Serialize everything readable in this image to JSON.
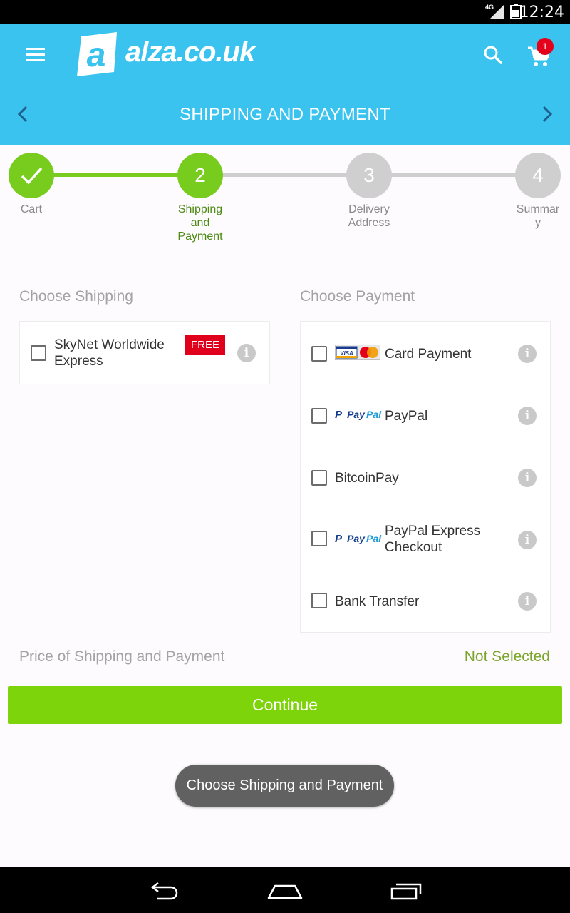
{
  "status_bar": {
    "network": "4G",
    "time": "12:24"
  },
  "header": {
    "brand": "alza.co.uk",
    "cart_count": "1",
    "title": "SHIPPING AND PAYMENT",
    "accent_color": "#3bc3ef"
  },
  "steps": [
    {
      "number": "",
      "label": "Cart",
      "state": "done"
    },
    {
      "number": "2",
      "label": "Shipping and Payment",
      "label_lines": [
        "Shipping",
        "and",
        "Payment"
      ],
      "state": "active"
    },
    {
      "number": "3",
      "label": "Delivery Address",
      "label_lines": [
        "Delivery",
        "Address"
      ],
      "state": "pending"
    },
    {
      "number": "4",
      "label": "Summary",
      "label_lines": [
        "Summar",
        "y"
      ],
      "state": "pending"
    }
  ],
  "shipping": {
    "title": "Choose Shipping",
    "options": [
      {
        "label_lines": [
          "SkyNet Worldwide",
          "Express"
        ],
        "badge": "FREE",
        "checked": false
      }
    ]
  },
  "payment": {
    "title": "Choose Payment",
    "options": [
      {
        "label": "Card Payment",
        "logo": "visa-mastercard-icon",
        "checked": false
      },
      {
        "label": "PayPal",
        "logo": "paypal-icon",
        "checked": false
      },
      {
        "label": "BitcoinPay",
        "logo": "",
        "checked": false
      },
      {
        "label_lines": [
          "PayPal Express",
          "Checkout"
        ],
        "logo": "paypal-icon",
        "checked": false
      },
      {
        "label": "Bank Transfer",
        "logo": "",
        "checked": false
      }
    ]
  },
  "summary": {
    "price_label": "Price of Shipping and Payment",
    "price_value": "Not Selected"
  },
  "continue_label": "Continue",
  "toast": "Choose Shipping and Payment",
  "colors": {
    "primary_green": "#7ed40a",
    "step_active": "#77cc1e",
    "step_pending": "#cfcfcf",
    "free_badge": "#e0001b"
  }
}
